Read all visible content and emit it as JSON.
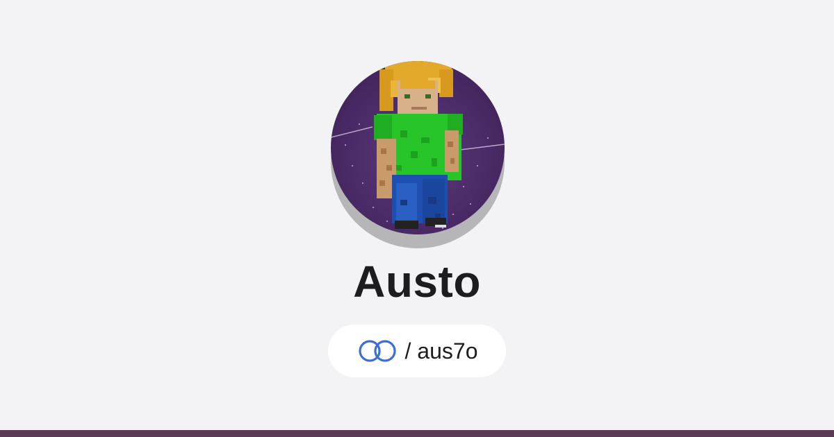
{
  "profile": {
    "display_name": "Austo",
    "handle_prefix": "/ ",
    "handle": "aus7o",
    "avatar": "minecraft-character-avatar"
  },
  "icons": {
    "platform_icon": "linked-rings-icon"
  },
  "colors": {
    "background": "#f3f3f5",
    "name_text": "#1d1d1f",
    "pill_background": "#ffffff",
    "icon_blue": "#3b6fd4",
    "bottom_bar": "#5b3a55",
    "avatar_bg": "#4a2a5e"
  }
}
